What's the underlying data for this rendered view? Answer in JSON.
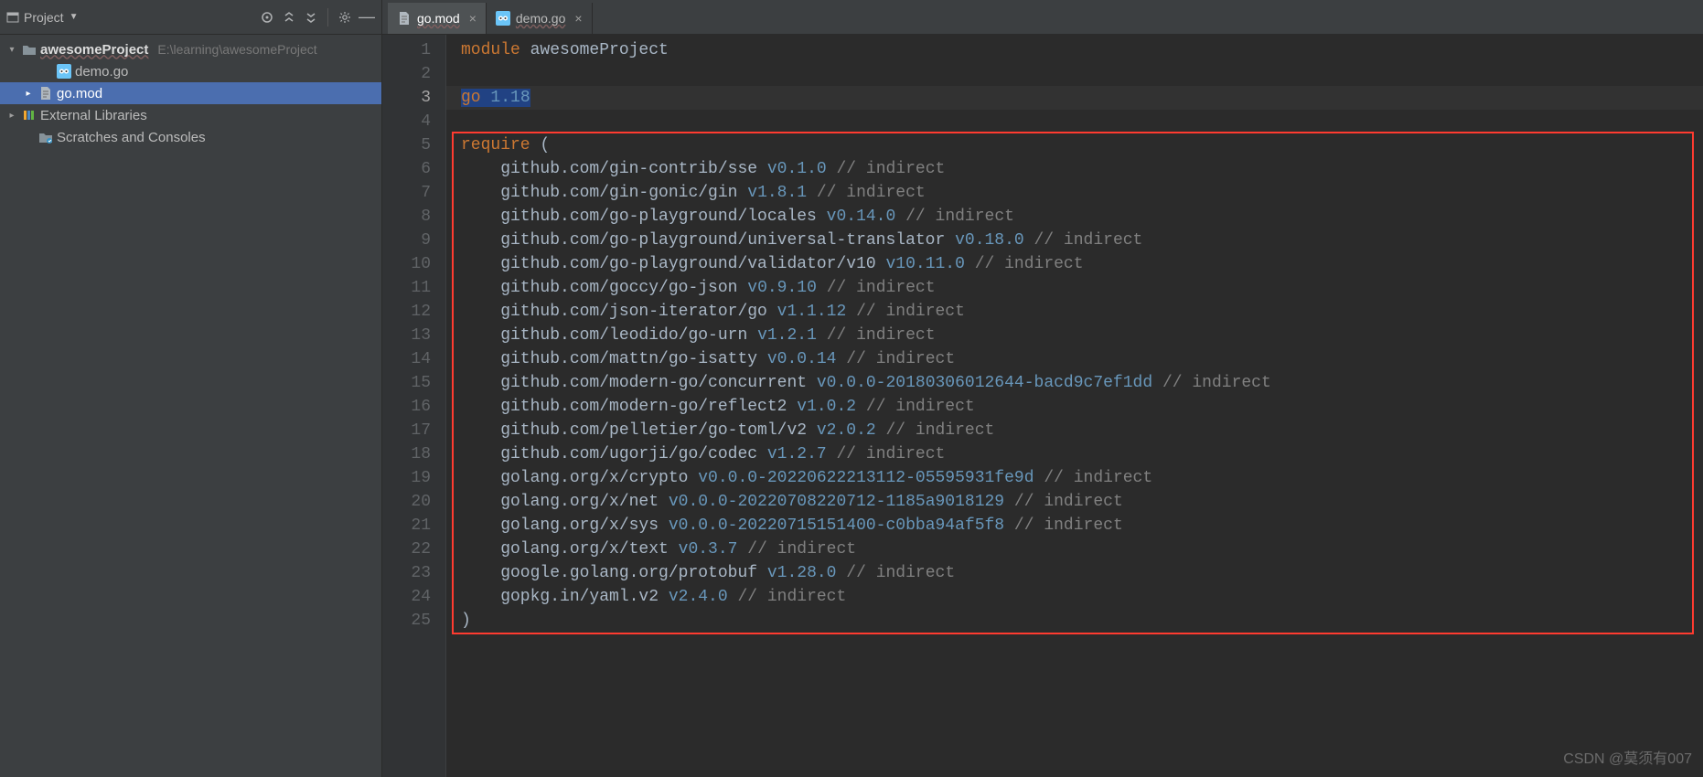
{
  "sidebar": {
    "title": "Project",
    "tree": {
      "root": {
        "name": "awesomeProject",
        "path": "E:\\learning\\awesomeProject"
      },
      "children": [
        {
          "name": "demo.go",
          "kind": "go"
        },
        {
          "name": "go.mod",
          "kind": "mod",
          "selected": true
        }
      ],
      "externalLibs": "External Libraries",
      "scratches": "Scratches and Consoles"
    }
  },
  "tabs": [
    {
      "label": "go.mod",
      "kind": "mod",
      "active": true
    },
    {
      "label": "demo.go",
      "kind": "go",
      "active": false
    }
  ],
  "code": {
    "moduleKw": "module",
    "moduleName": "awesomeProject",
    "goKw": "go",
    "goVersion": "1.18",
    "requireKw": "require",
    "openParen": "(",
    "closeParen": ")",
    "indirect": "// indirect",
    "deps": [
      {
        "path": "github.com/gin-contrib/sse",
        "ver": "v0.1.0"
      },
      {
        "path": "github.com/gin-gonic/gin",
        "ver": "v1.8.1"
      },
      {
        "path": "github.com/go-playground/locales",
        "ver": "v0.14.0"
      },
      {
        "path": "github.com/go-playground/universal-translator",
        "ver": "v0.18.0"
      },
      {
        "path": "github.com/go-playground/validator/v10",
        "ver": "v10.11.0"
      },
      {
        "path": "github.com/goccy/go-json",
        "ver": "v0.9.10"
      },
      {
        "path": "github.com/json-iterator/go",
        "ver": "v1.1.12"
      },
      {
        "path": "github.com/leodido/go-urn",
        "ver": "v1.2.1"
      },
      {
        "path": "github.com/mattn/go-isatty",
        "ver": "v0.0.14"
      },
      {
        "path": "github.com/modern-go/concurrent",
        "ver": "v0.0.0-20180306012644-bacd9c7ef1dd"
      },
      {
        "path": "github.com/modern-go/reflect2",
        "ver": "v1.0.2"
      },
      {
        "path": "github.com/pelletier/go-toml/v2",
        "ver": "v2.0.2"
      },
      {
        "path": "github.com/ugorji/go/codec",
        "ver": "v1.2.7"
      },
      {
        "path": "golang.org/x/crypto",
        "ver": "v0.0.0-20220622213112-05595931fe9d"
      },
      {
        "path": "golang.org/x/net",
        "ver": "v0.0.0-20220708220712-1185a9018129"
      },
      {
        "path": "golang.org/x/sys",
        "ver": "v0.0.0-20220715151400-c0bba94af5f8"
      },
      {
        "path": "golang.org/x/text",
        "ver": "v0.3.7"
      },
      {
        "path": "google.golang.org/protobuf",
        "ver": "v1.28.0"
      },
      {
        "path": "gopkg.in/yaml.v2",
        "ver": "v2.4.0"
      }
    ]
  },
  "watermark": "CSDN @莫须有007"
}
